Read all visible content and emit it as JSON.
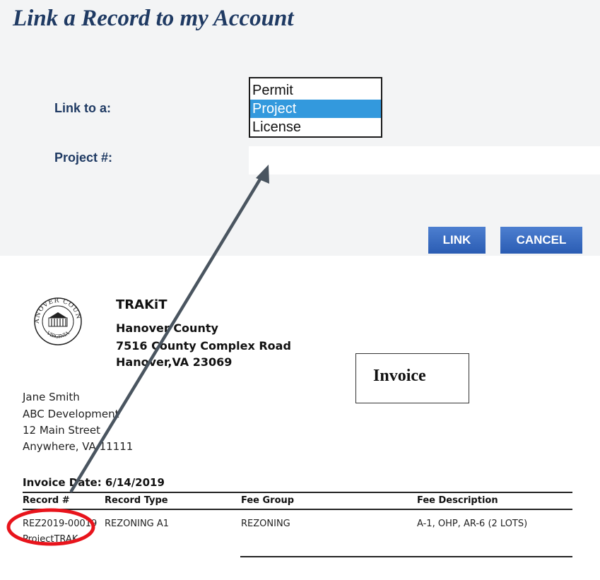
{
  "form": {
    "title": "Link a Record to my Account",
    "link_to_label": "Link to a:",
    "record_types": [
      "Permit",
      "Project",
      "License"
    ],
    "selected_type": "Project",
    "project_label": "Project #:",
    "project_value": "",
    "link_button": "LINK",
    "cancel_button": "CANCEL"
  },
  "invoice": {
    "company": {
      "name": "TRAKiT",
      "county": "Hanover County",
      "street": "7516 County Complex Road",
      "city": "Hanover,VA 23069"
    },
    "seal_text": {
      "top": "HANOVER COUNTY",
      "bottom": "VIRGINIA"
    },
    "heading": "Invoice",
    "recipient": {
      "name": "Jane Smith",
      "company": "ABC Development",
      "street": "12 Main Street",
      "city": "Anywhere, VA 11111"
    },
    "date_line": "Invoice Date: 6/14/2019",
    "columns": [
      "Record #",
      "Record Type",
      "Fee Group",
      "Fee Description"
    ],
    "row": {
      "record": "REZ2019-00019",
      "record_type": "REZONING A1",
      "fee_group": "REZONING",
      "fee_description": "A-1, OHP, AR-6 (2 LOTS)"
    },
    "record_sub": "ProjectTRAK"
  },
  "annotation": {
    "arrow_color": "#4a5560",
    "circle_color": "#e8141c"
  }
}
